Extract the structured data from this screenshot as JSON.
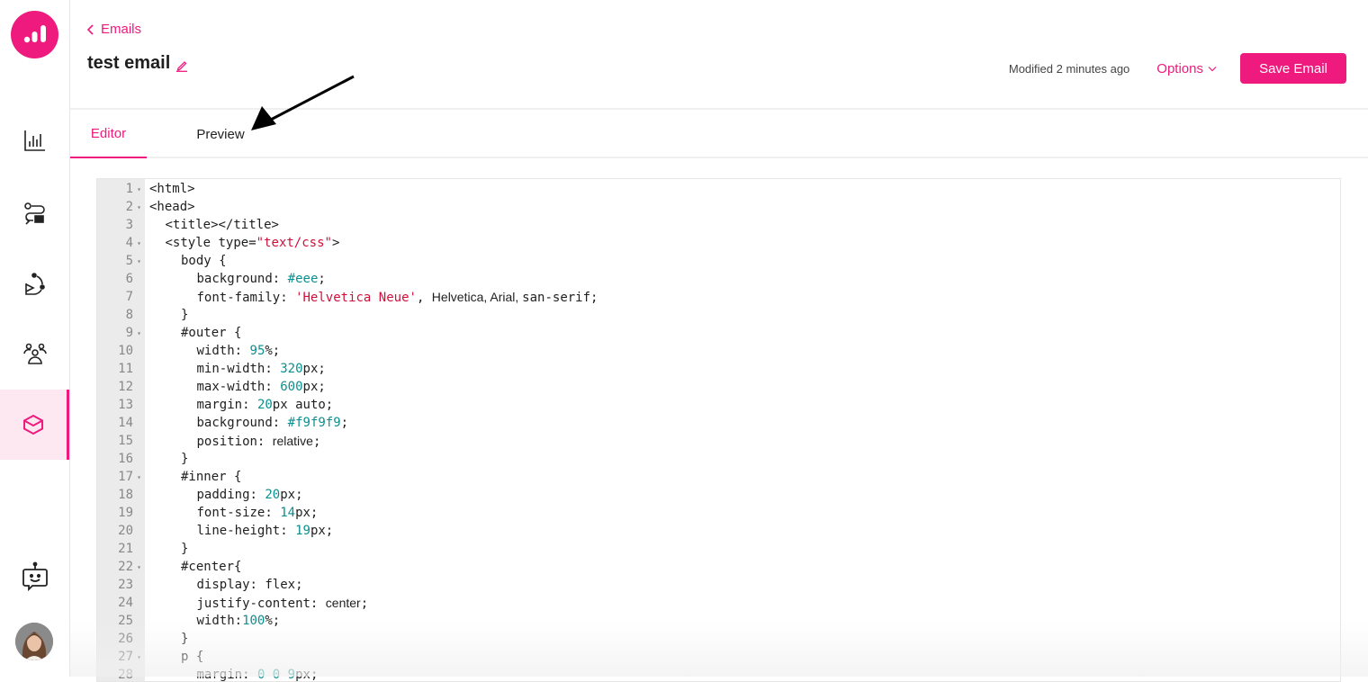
{
  "sidebar": {
    "logo": "analytics-logo",
    "items": [
      {
        "name": "analytics",
        "icon": "bar-chart-icon",
        "active": false
      },
      {
        "name": "flows",
        "icon": "flow-icon",
        "active": false
      },
      {
        "name": "journeys",
        "icon": "journey-icon",
        "active": false
      },
      {
        "name": "audience",
        "icon": "users-icon",
        "active": false
      },
      {
        "name": "templates",
        "icon": "box-icon",
        "active": true
      }
    ],
    "bot": "chatbot-icon",
    "avatar": "user-avatar"
  },
  "header": {
    "back_label": "Emails",
    "title": "test email",
    "modified": "Modified 2 minutes ago",
    "options_label": "Options",
    "save_label": "Save Email"
  },
  "tabs": [
    {
      "label": "Editor",
      "active": true
    },
    {
      "label": "Preview",
      "active": false
    }
  ],
  "colors": {
    "accent": "#ef1a7d",
    "string": "#d0103a",
    "number": "#0b8f8f"
  },
  "editor": {
    "lines": [
      {
        "n": "1",
        "fold": true,
        "indent": 0,
        "parts": [
          [
            "t",
            "<html>"
          ]
        ]
      },
      {
        "n": "2",
        "fold": true,
        "indent": 0,
        "parts": [
          [
            "t",
            "<head>"
          ]
        ]
      },
      {
        "n": "3",
        "fold": false,
        "indent": 1,
        "parts": [
          [
            "t",
            "<title></title>"
          ]
        ]
      },
      {
        "n": "4",
        "fold": true,
        "indent": 1,
        "parts": [
          [
            "t",
            "<style type="
          ],
          [
            "s",
            "\"text/css\""
          ],
          [
            "t",
            ">"
          ]
        ]
      },
      {
        "n": "5",
        "fold": true,
        "indent": 2,
        "parts": [
          [
            "t",
            "body {"
          ]
        ]
      },
      {
        "n": "6",
        "fold": false,
        "indent": 3,
        "parts": [
          [
            "t",
            "background: "
          ],
          [
            "n",
            "#eee"
          ],
          [
            "t",
            ";"
          ]
        ]
      },
      {
        "n": "7",
        "fold": false,
        "indent": 3,
        "parts": [
          [
            "t",
            "font-family: "
          ],
          [
            "s",
            "'Helvetica Neue'"
          ],
          [
            "t",
            ", "
          ],
          [
            "p",
            "Helvetica, Arial, "
          ],
          [
            "t",
            "san-serif;"
          ]
        ]
      },
      {
        "n": "8",
        "fold": false,
        "indent": 2,
        "parts": [
          [
            "t",
            "}"
          ]
        ]
      },
      {
        "n": "9",
        "fold": true,
        "indent": 2,
        "parts": [
          [
            "t",
            "#outer {"
          ]
        ]
      },
      {
        "n": "10",
        "fold": false,
        "indent": 3,
        "parts": [
          [
            "t",
            "width: "
          ],
          [
            "n",
            "95"
          ],
          [
            "t",
            "%;"
          ]
        ]
      },
      {
        "n": "11",
        "fold": false,
        "indent": 3,
        "parts": [
          [
            "t",
            "min-width: "
          ],
          [
            "n",
            "320"
          ],
          [
            "t",
            "px;"
          ]
        ]
      },
      {
        "n": "12",
        "fold": false,
        "indent": 3,
        "parts": [
          [
            "t",
            "max-width: "
          ],
          [
            "n",
            "600"
          ],
          [
            "t",
            "px;"
          ]
        ]
      },
      {
        "n": "13",
        "fold": false,
        "indent": 3,
        "parts": [
          [
            "t",
            "margin: "
          ],
          [
            "n",
            "20"
          ],
          [
            "t",
            "px auto;"
          ]
        ]
      },
      {
        "n": "14",
        "fold": false,
        "indent": 3,
        "parts": [
          [
            "t",
            "background: "
          ],
          [
            "n",
            "#f9f9f9"
          ],
          [
            "t",
            ";"
          ]
        ]
      },
      {
        "n": "15",
        "fold": false,
        "indent": 3,
        "parts": [
          [
            "t",
            "position: "
          ],
          [
            "p",
            "relative"
          ],
          [
            "t",
            ";"
          ]
        ]
      },
      {
        "n": "16",
        "fold": false,
        "indent": 2,
        "parts": [
          [
            "t",
            "}"
          ]
        ]
      },
      {
        "n": "17",
        "fold": true,
        "indent": 2,
        "parts": [
          [
            "t",
            "#inner {"
          ]
        ]
      },
      {
        "n": "18",
        "fold": false,
        "indent": 3,
        "parts": [
          [
            "t",
            "padding: "
          ],
          [
            "n",
            "20"
          ],
          [
            "t",
            "px;"
          ]
        ]
      },
      {
        "n": "19",
        "fold": false,
        "indent": 3,
        "parts": [
          [
            "t",
            "font-size: "
          ],
          [
            "n",
            "14"
          ],
          [
            "t",
            "px;"
          ]
        ]
      },
      {
        "n": "20",
        "fold": false,
        "indent": 3,
        "parts": [
          [
            "t",
            "line-height: "
          ],
          [
            "n",
            "19"
          ],
          [
            "t",
            "px;"
          ]
        ]
      },
      {
        "n": "21",
        "fold": false,
        "indent": 2,
        "parts": [
          [
            "t",
            "}"
          ]
        ]
      },
      {
        "n": "22",
        "fold": true,
        "indent": 2,
        "parts": [
          [
            "t",
            "#center{"
          ]
        ]
      },
      {
        "n": "23",
        "fold": false,
        "indent": 3,
        "parts": [
          [
            "t",
            "display: flex;"
          ]
        ]
      },
      {
        "n": "24",
        "fold": false,
        "indent": 3,
        "parts": [
          [
            "t",
            "justify-content: "
          ],
          [
            "p",
            "center"
          ],
          [
            "t",
            ";"
          ]
        ]
      },
      {
        "n": "25",
        "fold": false,
        "indent": 3,
        "parts": [
          [
            "t",
            "width:"
          ],
          [
            "n",
            "100"
          ],
          [
            "t",
            "%;"
          ]
        ]
      },
      {
        "n": "26",
        "fold": false,
        "indent": 2,
        "parts": [
          [
            "t",
            "}"
          ]
        ]
      },
      {
        "n": "27",
        "fold": true,
        "indent": 2,
        "parts": [
          [
            "t",
            "p {"
          ]
        ]
      },
      {
        "n": "28",
        "fold": false,
        "indent": 3,
        "parts": [
          [
            "t",
            "margin: "
          ],
          [
            "n",
            "0 0 9"
          ],
          [
            "t",
            "px;"
          ]
        ]
      }
    ]
  }
}
